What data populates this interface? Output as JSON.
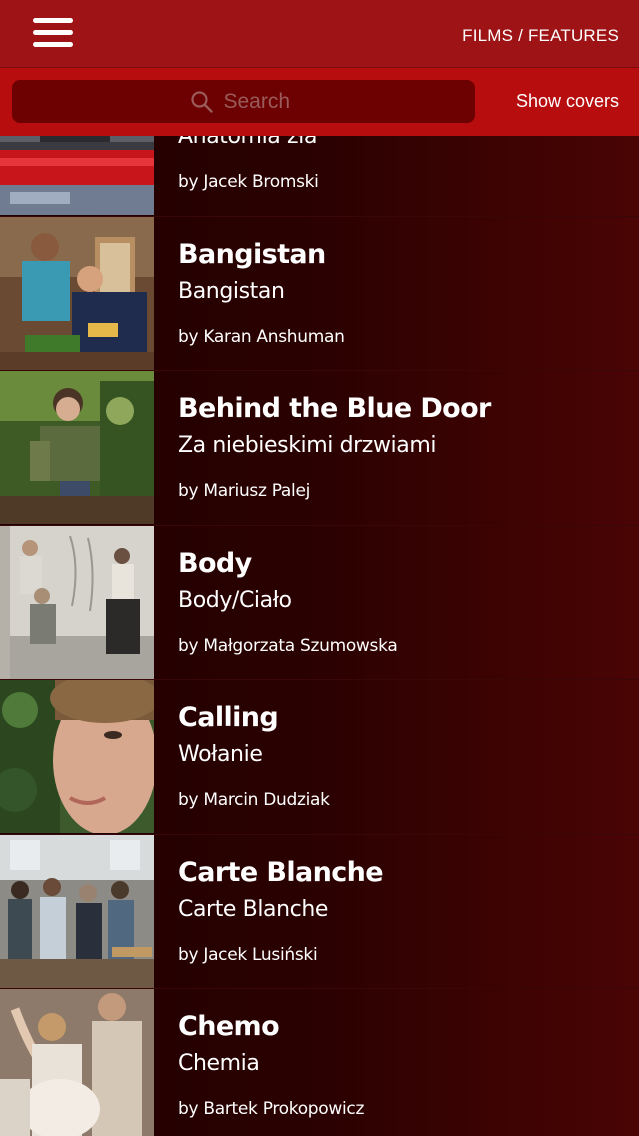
{
  "header": {
    "menu_icon": "hamburger-menu-icon",
    "breadcrumb": "FILMS / FEATURES"
  },
  "search": {
    "placeholder": "Search",
    "value": "",
    "icon": "search-icon",
    "show_covers_label": "Show covers"
  },
  "colors": {
    "header_bg": "#9e1416",
    "search_bar_bg": "#b70d0f",
    "search_field_bg": "#6d0000",
    "list_bg": "#240000",
    "text": "#ffffff"
  },
  "films": [
    {
      "title": "",
      "original_title": "Anatomia zła",
      "director": "by Jacek Bromski"
    },
    {
      "title": "Bangistan",
      "original_title": "Bangistan",
      "director": "by Karan Anshuman"
    },
    {
      "title": "Behind the Blue Door",
      "original_title": "Za niebieskimi drzwiami",
      "director": "by Mariusz Palej"
    },
    {
      "title": "Body",
      "original_title": "Body/Ciało",
      "director": "by Małgorzata Szumowska"
    },
    {
      "title": "Calling",
      "original_title": "Wołanie",
      "director": "by Marcin Dudziak"
    },
    {
      "title": "Carte Blanche",
      "original_title": "Carte Blanche",
      "director": "by Jacek Lusiński"
    },
    {
      "title": "Chemo",
      "original_title": "Chemia",
      "director": "by Bartek Prokopowicz"
    }
  ]
}
